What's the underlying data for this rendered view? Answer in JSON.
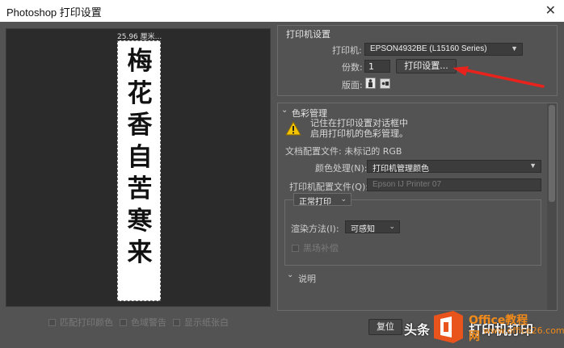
{
  "window": {
    "title": "Photoshop 打印设置",
    "close_glyph": "✕"
  },
  "preview": {
    "dimension_label": "25.96 厘米...",
    "characters": [
      "梅",
      "花",
      "香",
      "自",
      "苦",
      "寒",
      "来"
    ]
  },
  "preview_options": [
    {
      "label": "匹配打印颜色",
      "checked": false
    },
    {
      "label": "色域警告",
      "checked": false
    },
    {
      "label": "显示纸张白",
      "checked": false
    }
  ],
  "printer_setup": {
    "section_title": "打印机设置",
    "printer_label": "打印机:",
    "printer_value": "EPSON4932BE (L15160 Series)",
    "copies_label": "份数:",
    "copies_value": "1",
    "print_settings_button": "打印设置...",
    "layout_label": "版面:",
    "orientation_icons": [
      "portrait-icon",
      "landscape-icon"
    ]
  },
  "color_management": {
    "section_title": "色彩管理",
    "warning_line1": "记住在打印设置对话框中",
    "warning_line2": "启用打印机的色彩管理。",
    "doc_profile": "文档配置文件: 未标记的 RGB",
    "color_handling_label": "颜色处理(N):",
    "color_handling_value": "打印机管理颜色",
    "printer_profile_label": "打印机配置文件(Q):",
    "printer_profile_value": "Epson IJ Printer 07",
    "mode_value": "正常打印",
    "intent_label": "渲染方法(I):",
    "intent_value": "可感知",
    "bpc_label": "黑场补偿",
    "bpc_checked": false
  },
  "description": {
    "section_title": "说明"
  },
  "buttons": {
    "reset": "复位"
  },
  "watermark": {
    "prefix": "头条",
    "suffix": "打印机打印",
    "site": "Office教程网",
    "domain": "www.office26.com"
  },
  "colors": {
    "accent_arrow": "#e8231d",
    "logo": "#e8541b",
    "site_text": "#f08a1a"
  }
}
